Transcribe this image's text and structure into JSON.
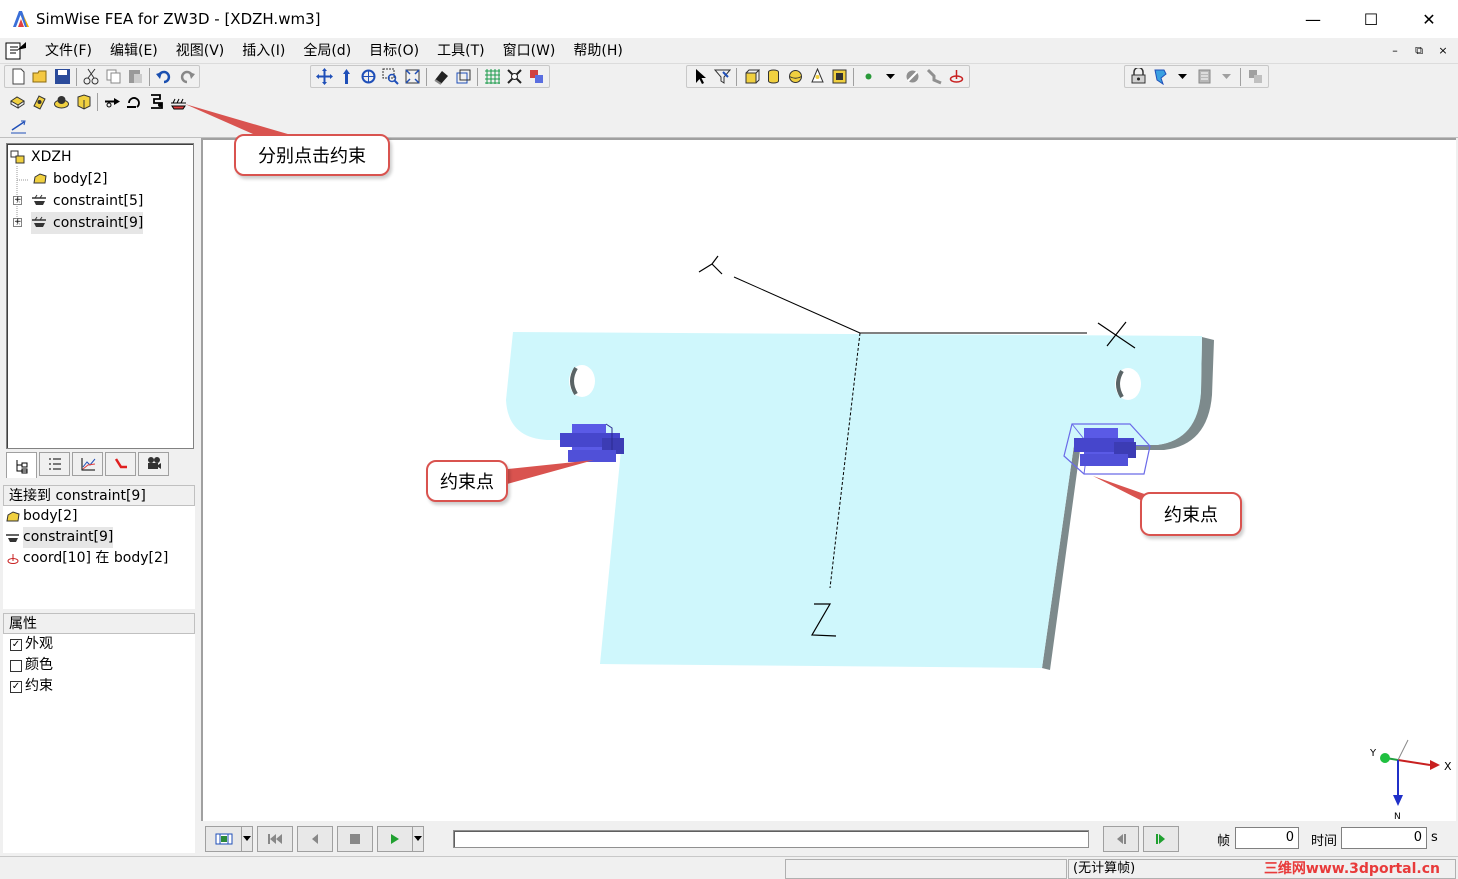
{
  "window": {
    "title": "SimWise FEA for ZW3D - [XDZH.wm3]",
    "minimize": "—",
    "maximize": "☐",
    "close": "✕"
  },
  "menu": {
    "items": [
      "文件(F)",
      "编辑(E)",
      "视图(V)",
      "插入(I)",
      "全局(d)",
      "目标(O)",
      "工具(T)",
      "窗口(W)",
      "帮助(H)"
    ],
    "mdi_minimize": "–",
    "mdi_restore": "⧉",
    "mdi_close": "×"
  },
  "tree": {
    "root": "XDZH",
    "items": [
      "body[2]",
      "constraint[5]",
      "constraint[9]"
    ]
  },
  "connections": {
    "header": "连接到 constraint[9]",
    "items": [
      "body[2]",
      "constraint[9]",
      "coord[10] 在 body[2]"
    ]
  },
  "properties": {
    "header": "属性",
    "items": [
      {
        "label": "外观",
        "checked": true
      },
      {
        "label": "颜色",
        "checked": false
      },
      {
        "label": "约束",
        "checked": true
      }
    ],
    "check_mark": "✓"
  },
  "viewport": {
    "axis_y": "Y",
    "axis_x": "X",
    "axis_z": "Z",
    "triad_x": "X",
    "triad_y": "Y",
    "triad_z": "N",
    "plate_color": "#cff7fc",
    "plate_edge_color": "#7d8a8c",
    "constraint_color": "#5a5ae6"
  },
  "annotations": {
    "click_constraints": "分别点击约束",
    "constraint_point_left": "约束点",
    "constraint_point_right": "约束点",
    "accent_color": "#d9534f"
  },
  "animation": {
    "frame_label": "帧",
    "frame_value": "0",
    "time_label": "时间",
    "time_value": "0",
    "time_unit": "s"
  },
  "status": {
    "uncomputed": "(无计算帧)",
    "watermark": "三维网www.3dportal.cn"
  }
}
